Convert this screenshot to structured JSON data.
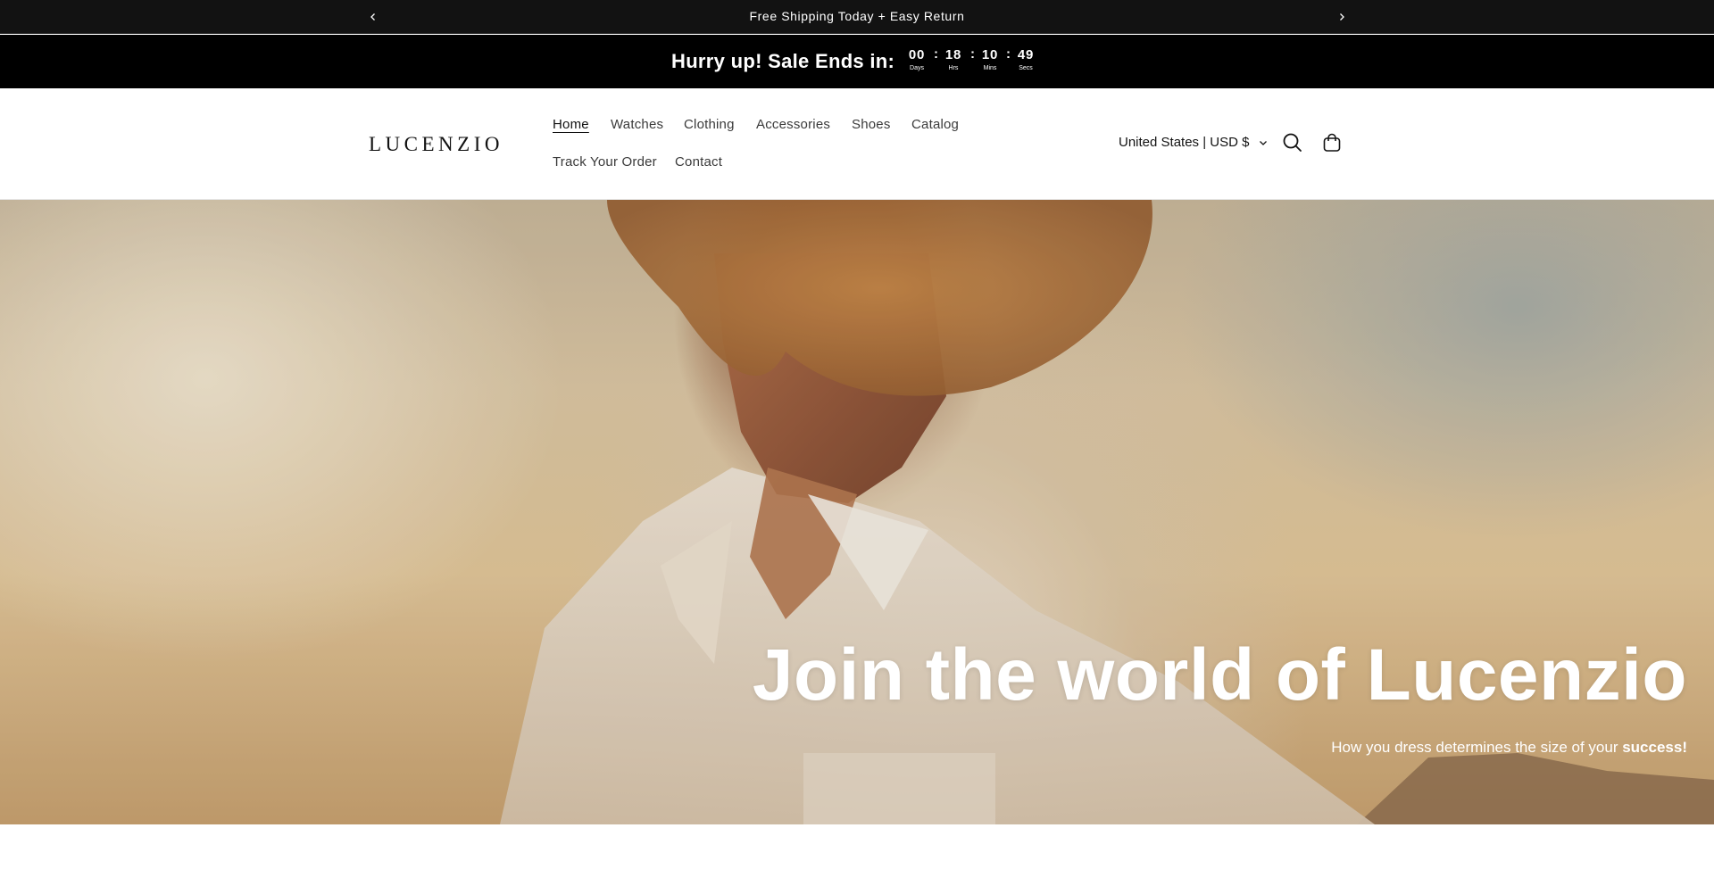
{
  "announcement": {
    "text": "Free Shipping Today + Easy Return",
    "prev_icon": "chevron-left-icon",
    "next_icon": "chevron-right-icon"
  },
  "countdown": {
    "heading": "Hurry up! Sale Ends in:",
    "units": [
      {
        "value": "00",
        "label": "Days"
      },
      {
        "value": "18",
        "label": "Hrs"
      },
      {
        "value": "10",
        "label": "Mins"
      },
      {
        "value": "49",
        "label": "Secs"
      }
    ],
    "separator": ":"
  },
  "header": {
    "logo": "LUCENZIO",
    "nav": [
      {
        "label": "Home",
        "active": true
      },
      {
        "label": "Watches"
      },
      {
        "label": "Clothing"
      },
      {
        "label": "Accessories"
      },
      {
        "label": "Shoes"
      },
      {
        "label": "Catalog"
      },
      {
        "label": "Track Your Order"
      },
      {
        "label": "Contact"
      }
    ],
    "localization": "United States | USD $",
    "icons": [
      "search-icon",
      "cart-icon"
    ]
  },
  "hero": {
    "title": "Join the world of Lucenzio",
    "subtitle_plain": "How you dress determines the size of your ",
    "subtitle_bold": "success!"
  },
  "colors": {
    "announcement_bg": "#121212",
    "countdown_bg": "#000000",
    "text_dark": "#121212",
    "hero_text": "#ffffff"
  }
}
